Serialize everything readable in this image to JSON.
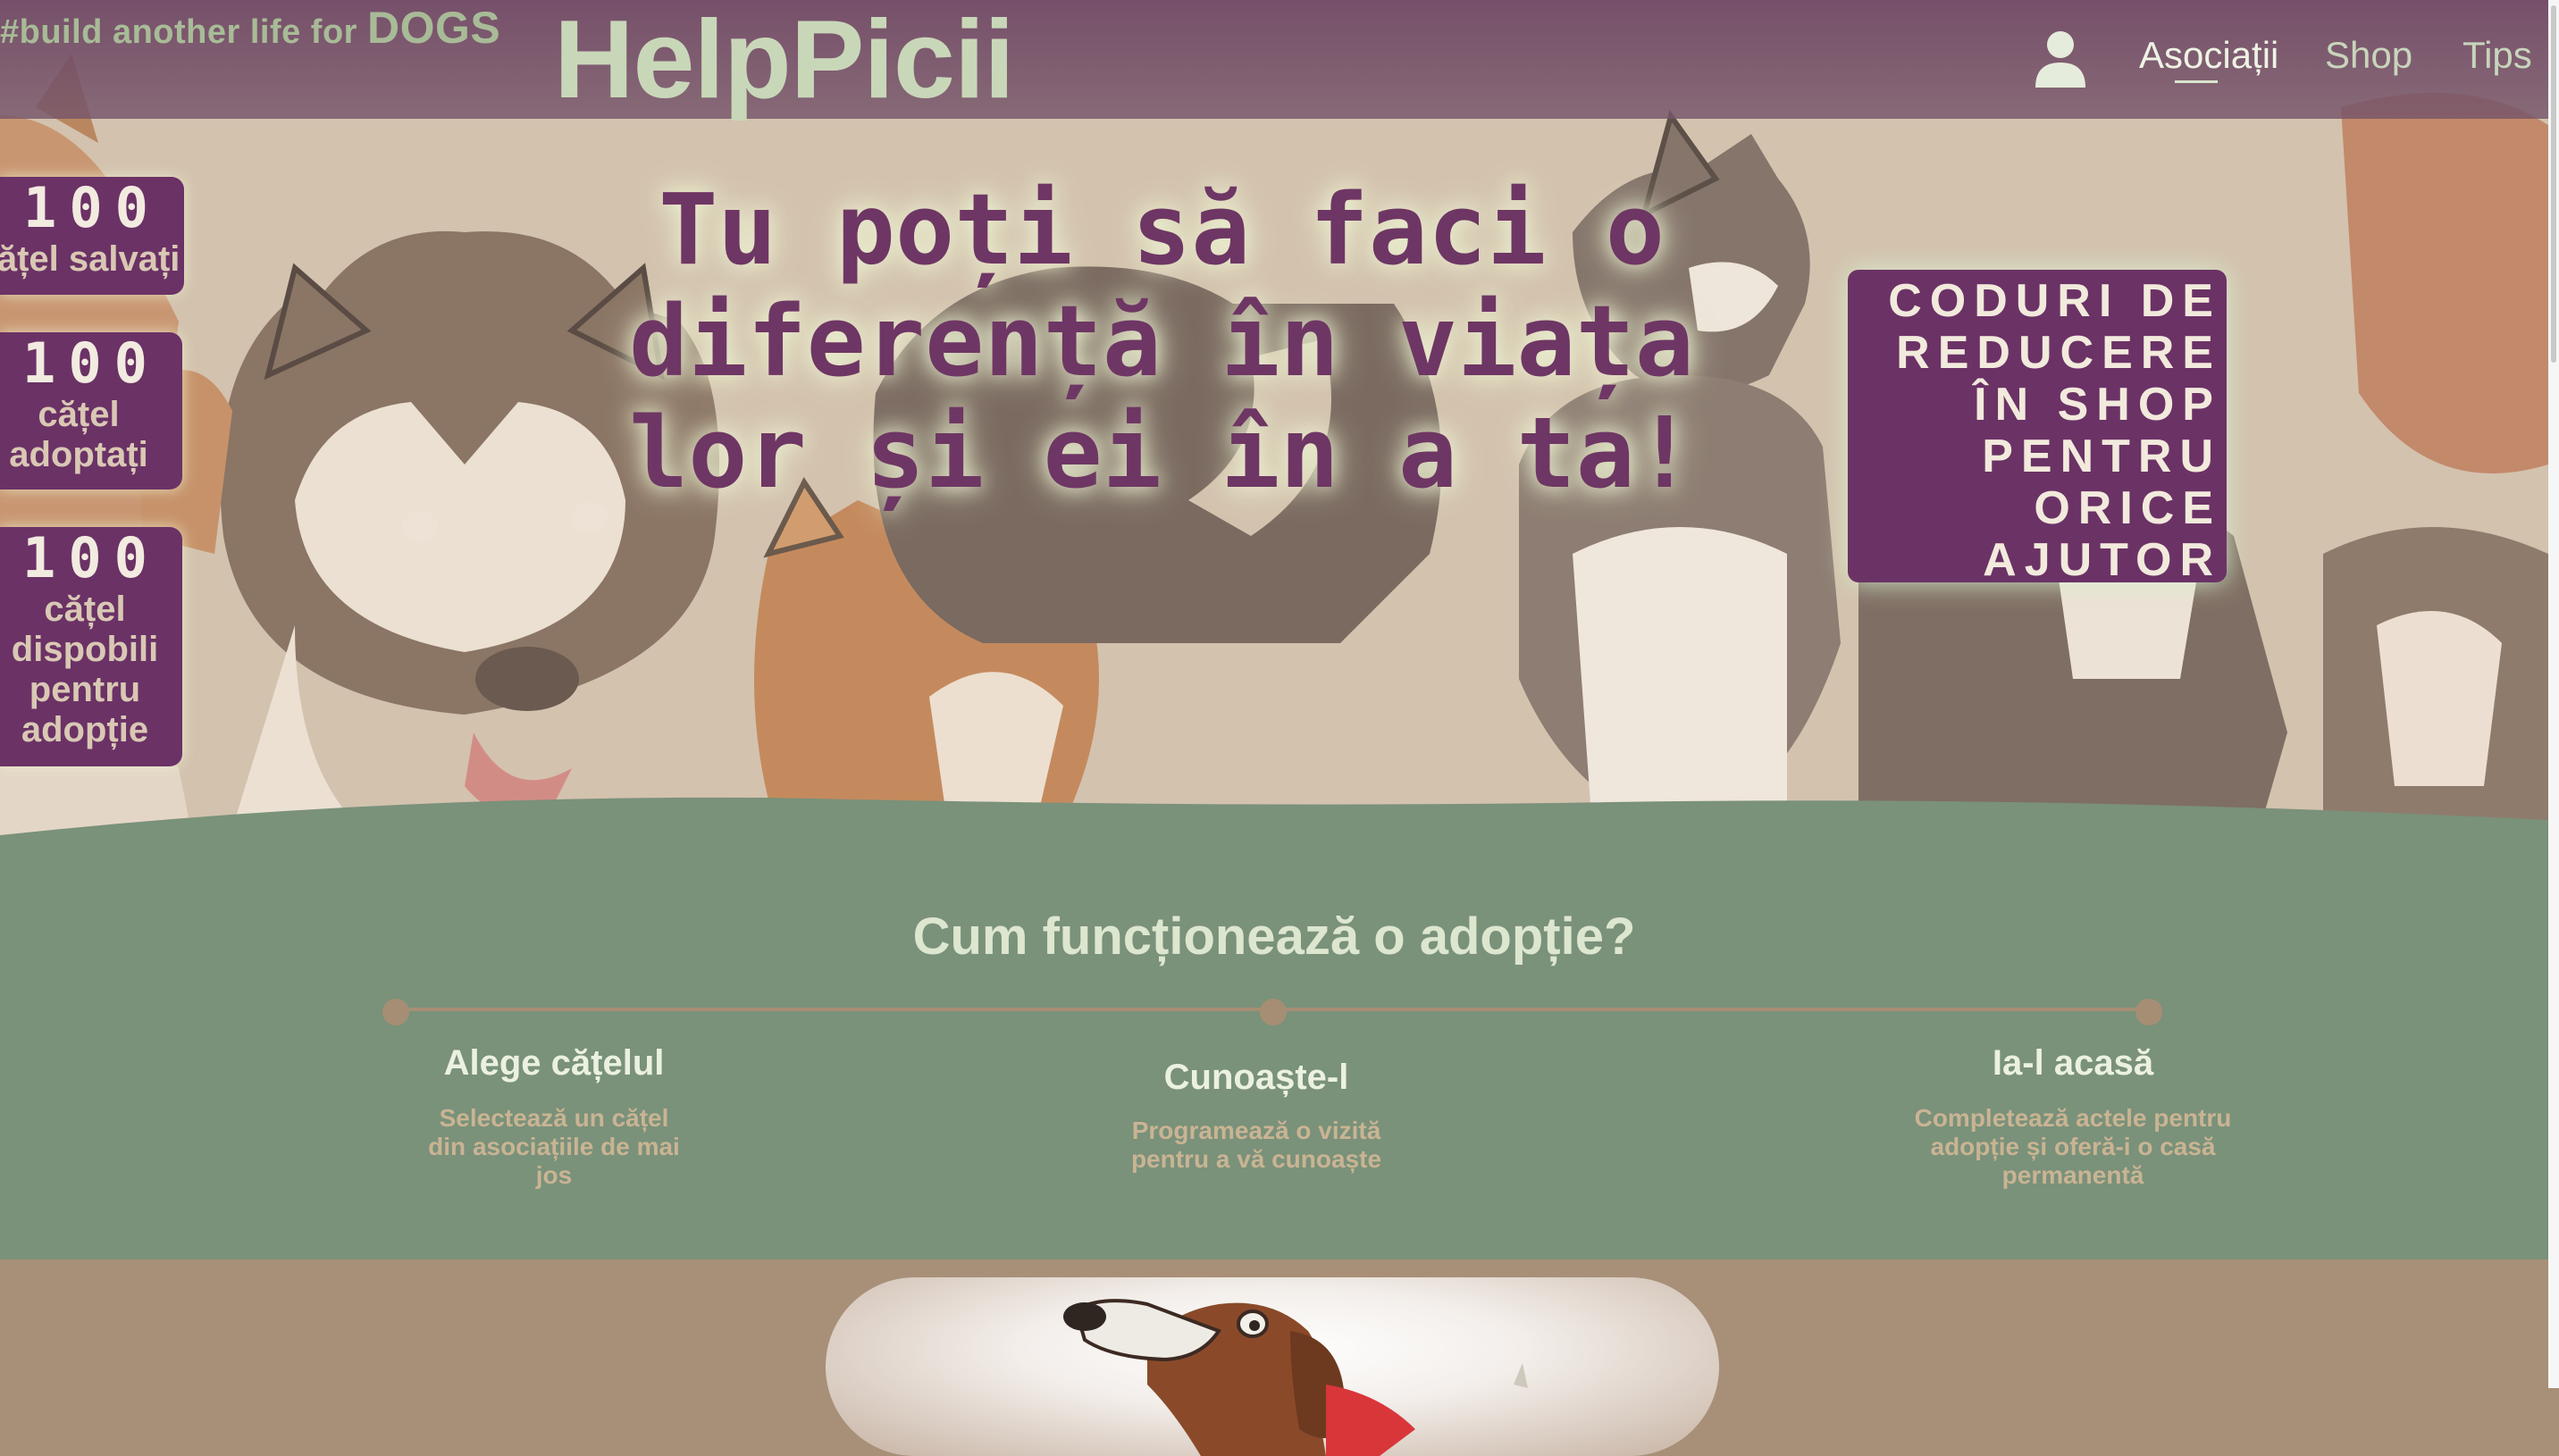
{
  "header": {
    "tagline_prefix": "#build another life for",
    "tagline_dogs": "DOGS",
    "brand": "HelpPicii",
    "nav": [
      {
        "label": "Asociații",
        "active": true
      },
      {
        "label": "Shop",
        "active": false
      },
      {
        "label": "Tips",
        "active": false
      }
    ],
    "user_icon": "user-icon"
  },
  "hero": {
    "headline": "Tu poți să faci o diferență în viața lor și ei în a ta!",
    "stats": [
      {
        "number": "100",
        "label": "cățel salvați"
      },
      {
        "number": "100",
        "label": "cățel adoptați"
      },
      {
        "number": "100",
        "label": "cățel dispobili pentru adopție"
      }
    ],
    "promo": "CODURI DE REDUCERE ÎN SHOP PENTRU ORICE AJUTOR"
  },
  "how_it_works": {
    "title": "Cum funcționează o adopție?",
    "steps": [
      {
        "title": "Alege cățelul",
        "desc": "Selectează un cățel din asociațiile de mai jos"
      },
      {
        "title": "Cunoaște-l",
        "desc": "Programează o vizită pentru a vă cunoaște"
      },
      {
        "title": "Ia-l acasă",
        "desc": "Completează actele pentru adopție și oferă-i o casă permanentă"
      }
    ]
  },
  "colors": {
    "purple": "#6b3266",
    "green_section": "#7a917a",
    "tan_section": "#a88f78",
    "timeline": "#a68e74"
  }
}
